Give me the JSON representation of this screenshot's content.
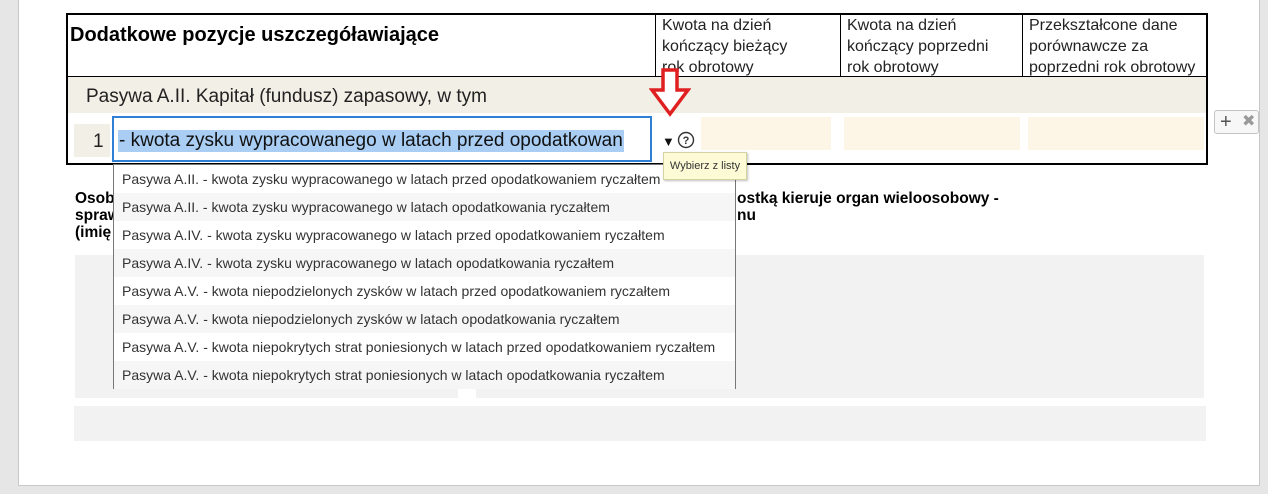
{
  "table": {
    "title": "Dodatkowe pozycje uszczegóławiające",
    "columns": [
      {
        "line1": "Kwota na dzień",
        "line2": "kończący bieżący",
        "line3": "rok obrotowy"
      },
      {
        "line1": "Kwota na dzień",
        "line2": "kończący poprzedni",
        "line3": "rok obrotowy"
      },
      {
        "line1": "Przekształcone dane",
        "line2": "porównawcze za",
        "line3": "poprzedni rok obrotowy"
      }
    ],
    "section_label": "Pasywa A.II. Kapitał (fundusz) zapasowy, w tym",
    "row_number": "1",
    "selected_value": "- kwota zysku wypracowanego w latach przed opodatkowan"
  },
  "controls": {
    "dropdown_arrow": "▼",
    "help_icon": "help-circle-icon",
    "tooltip": "Wybierz z listy",
    "add_symbol": "+",
    "remove_symbol": "✖"
  },
  "below": {
    "left_line1": "Osob",
    "left_line2": "spraw",
    "left_line3": "(imię",
    "right_line1": "ostką kieruje organ wieloosobowy -",
    "right_line2": "nu"
  },
  "dropdown_options": [
    "Pasywa A.II. - kwota zysku wypracowanego w latach przed opodatkowaniem ryczałtem",
    "Pasywa A.II. - kwota zysku wypracowanego w latach opodatkowania ryczałtem",
    "Pasywa A.IV. - kwota zysku wypracowanego w latach przed opodatkowaniem ryczałtem",
    "Pasywa A.IV. - kwota zysku wypracowanego w latach opodatkowania ryczałtem",
    "Pasywa A.V. - kwota niepodzielonych zysków w latach przed opodatkowaniem ryczałtem",
    "Pasywa A.V. - kwota niepodzielonych zysków w latach opodatkowania ryczałtem",
    "Pasywa A.V. - kwota niepokrytych strat poniesionych w latach przed opodatkowaniem ryczałtem",
    "Pasywa A.V. - kwota niepokrytych strat poniesionych w latach opodatkowania ryczałtem"
  ],
  "colors": {
    "accent_arrow": "#e02020",
    "focus_border": "#2f7fd6",
    "selection": "#a9cdf3"
  }
}
